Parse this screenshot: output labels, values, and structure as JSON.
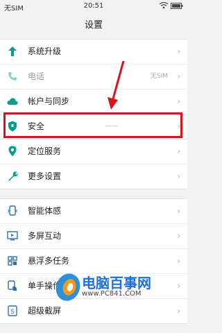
{
  "status_bar": {
    "carrier": "无SIM",
    "time": "20:51"
  },
  "header": {
    "title": "设置"
  },
  "group1": [
    {
      "label": "系统升级",
      "icon": "up-arrow-icon"
    },
    {
      "label": "电话",
      "value": "无SIM",
      "icon": "phone-icon",
      "dimmed": true
    },
    {
      "label": "帐户与同步",
      "icon": "cloud-icon"
    },
    {
      "label": "安全",
      "icon": "shield-icon",
      "value": "——"
    }
  ],
  "group2": [
    {
      "label": "定位服务",
      "icon": "location-icon"
    },
    {
      "label": "更多设置",
      "icon": "wrench-icon"
    }
  ],
  "group3": [
    {
      "label": "智能体感",
      "icon": "motion-icon"
    },
    {
      "label": "多屏互动",
      "icon": "multiscreen-icon"
    },
    {
      "label": "悬浮多任务",
      "icon": "multitask-icon"
    },
    {
      "label": "单手操作",
      "icon": "one-hand-icon"
    },
    {
      "label": "超级截屏",
      "icon": "screenshot-icon"
    }
  ],
  "watermark": {
    "brand": "电脑百事网",
    "url": "www.PC841.COM"
  },
  "colors": {
    "accent": "#0a9b8e",
    "highlight": "#d8121b",
    "brand": "#1f6fd8"
  }
}
